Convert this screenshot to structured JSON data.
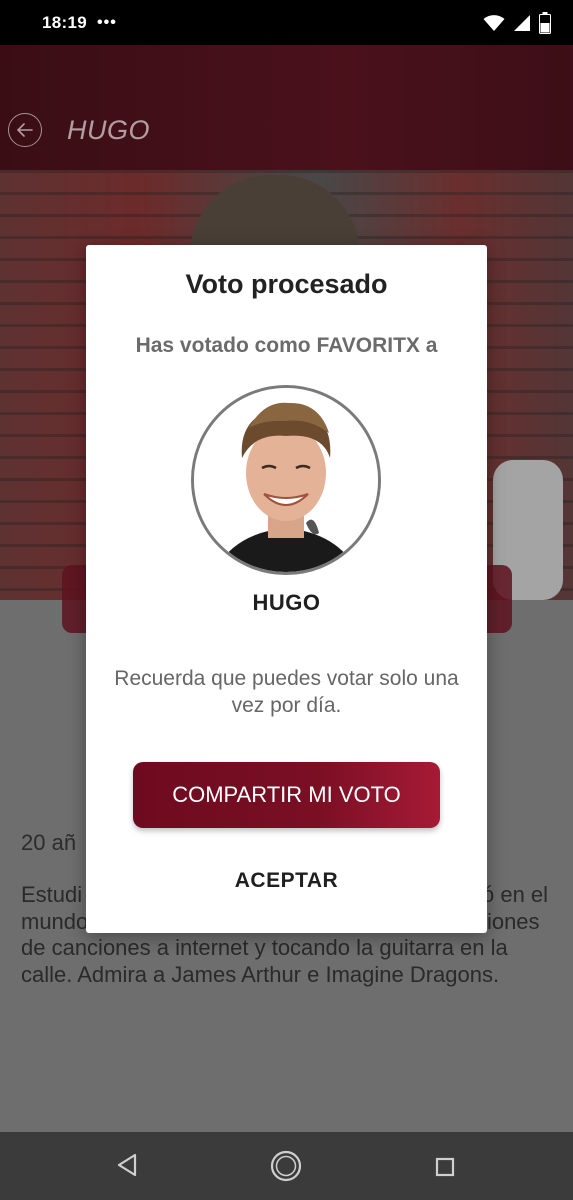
{
  "status_bar": {
    "time": "18:19",
    "dots": "•••",
    "icons": [
      "wifi-icon",
      "signal-icon",
      "battery-icon"
    ]
  },
  "header": {
    "title": "HUGO",
    "back_icon": "arrow-left-icon"
  },
  "body": {
    "age": "20 añ",
    "bio": "Estudi                                                       te trabaj                                                    duos y como mecánico. Se inició en el mundo de la música con 13 años subiendo versiones de canciones a internet y tocando la guitarra en la calle. Admira a James Arthur e Imagine Dragons."
  },
  "modal": {
    "title": "Voto procesado",
    "subtitle": "Has votado como FAVORITX a",
    "candidate_name": "HUGO",
    "note": "Recuerda que puedes votar solo una vez por día.",
    "share_label": "COMPARTIR MI VOTO",
    "accept_label": "ACEPTAR"
  },
  "nav_bar": {
    "icons": [
      "nav-back-icon",
      "nav-home-icon",
      "nav-recent-icon"
    ]
  },
  "colors": {
    "brand": "#7a0f24",
    "header_bg": "#4a111b",
    "status_bg": "#000000",
    "nav_bg": "#3b3b3b"
  }
}
